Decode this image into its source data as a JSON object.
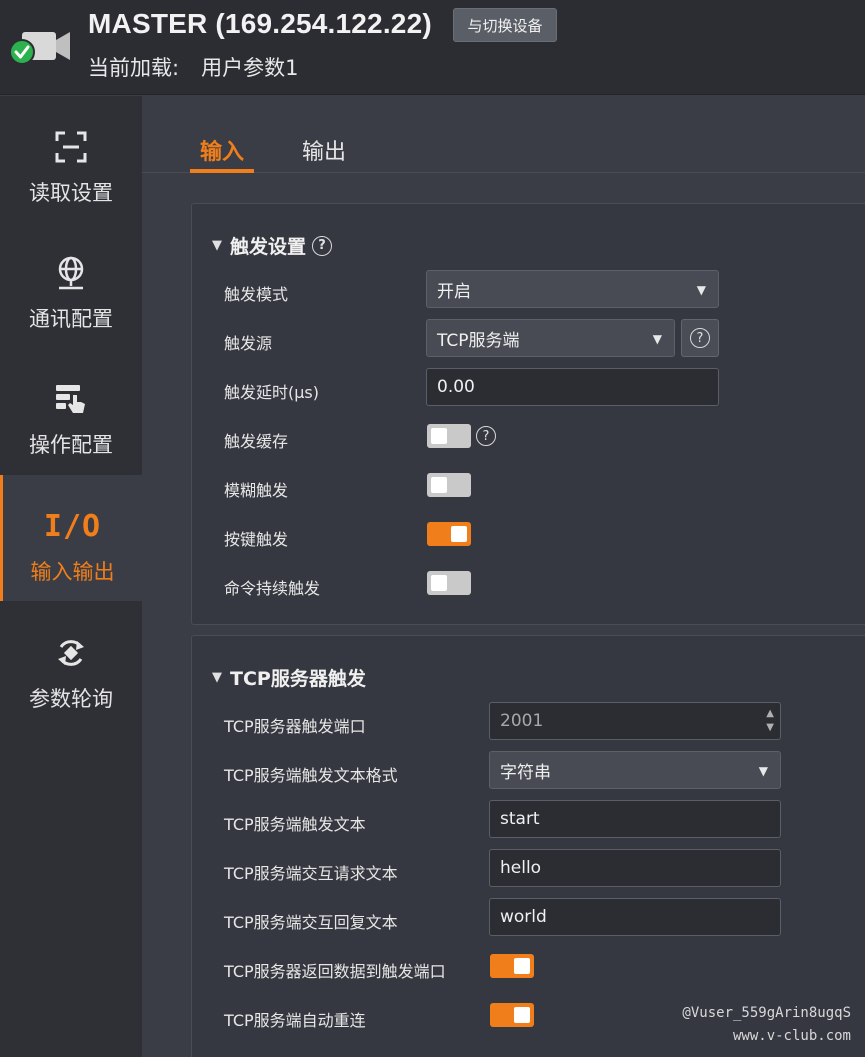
{
  "header": {
    "device_name": "MASTER (169.254.122.22)",
    "switch_button": "与切换设备",
    "current_load_label": "当前加载:",
    "current_load_value": "用户参数1",
    "status_color": "#2bb24c"
  },
  "sidebar": {
    "items": [
      {
        "label": "读取设置",
        "icon": "scan-frame-icon"
      },
      {
        "label": "通讯配置",
        "icon": "globe-network-icon"
      },
      {
        "label": "操作配置",
        "icon": "settings-hand-icon"
      },
      {
        "label": "输入输出",
        "icon": "io-icon",
        "icon_text": "I/O",
        "active": true
      },
      {
        "label": "参数轮询",
        "icon": "cycle-icon"
      }
    ]
  },
  "tabs": [
    {
      "label": "输入",
      "active": true
    },
    {
      "label": "输出",
      "active": false
    }
  ],
  "trigger_settings": {
    "title": "触发设置",
    "mode_label": "触发模式",
    "mode_value": "开启",
    "source_label": "触发源",
    "source_value": "TCP服务端",
    "delay_label": "触发延时(μs)",
    "delay_value": "0.00",
    "cache_label": "触发缓存",
    "cache_on": false,
    "fuzzy_label": "模糊触发",
    "fuzzy_on": false,
    "key_label": "按键触发",
    "key_on": true,
    "cmd_label": "命令持续触发",
    "cmd_on": false
  },
  "tcp_trigger": {
    "title": "TCP服务器触发",
    "port_label": "TCP服务器触发端口",
    "port_value": "2001",
    "format_label": "TCP服务端触发文本格式",
    "format_value": "字符串",
    "text_label": "TCP服务端触发文本",
    "text_value": "start",
    "request_label": "TCP服务端交互请求文本",
    "request_value": "hello",
    "reply_label": "TCP服务端交互回复文本",
    "reply_value": "world",
    "return_label": "TCP服务器返回数据到触发端口",
    "return_on": true,
    "reconnect_label": "TCP服务端自动重连",
    "reconnect_on": true
  },
  "watermark": {
    "line1": "@Vuser_559gArin8ugqS",
    "line2": "www.v-club.com"
  },
  "colors": {
    "accent": "#f07e1b",
    "background": "#3a3d45",
    "sidebar": "#2e3036"
  }
}
